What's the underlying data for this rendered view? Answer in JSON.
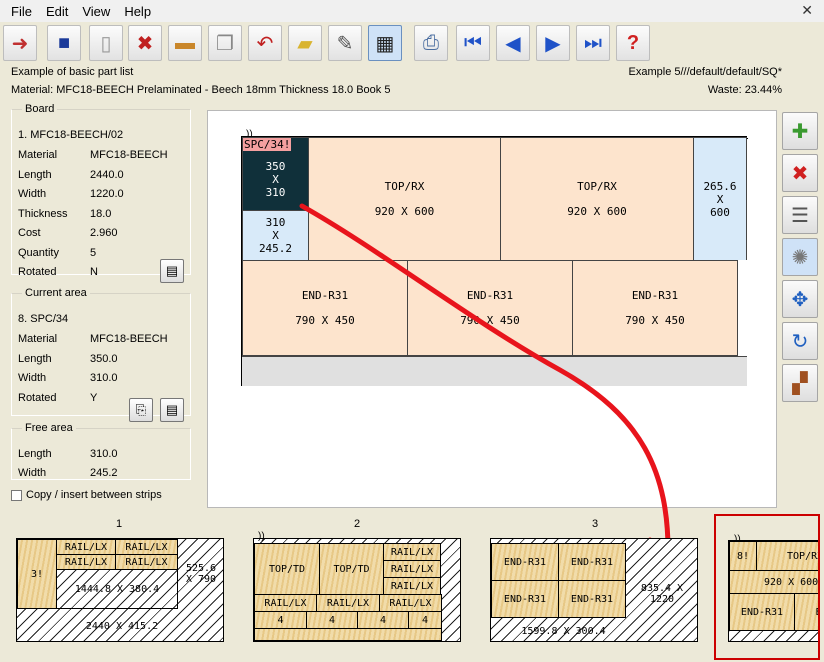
{
  "menu": [
    "File",
    "Edit",
    "View",
    "Help"
  ],
  "toolbar_icons": [
    "exit-icon",
    "save-icon",
    "new-icon",
    "delete-icon",
    "board-icon",
    "copy-icon",
    "undo-icon",
    "open-folder-icon",
    "edit-icon",
    "layout-icon",
    "print-icon",
    "first-icon",
    "previous-icon",
    "next-icon",
    "last-icon",
    "help-icon"
  ],
  "header": {
    "title": "Example of basic part list",
    "path": "Example 5///default/default/SQ*",
    "material": "Material: MFC18-BEECH Prelaminated - Beech 18mm Thickness  18.0 Book 5",
    "waste": "Waste: 23.44%"
  },
  "board": {
    "legend": "Board",
    "name": "1. MFC18-BEECH/02",
    "rows": [
      {
        "label": "Material",
        "value": "MFC18-BEECH"
      },
      {
        "label": "Length",
        "value": "2440.0"
      },
      {
        "label": "Width",
        "value": "1220.0"
      },
      {
        "label": "Thickness",
        "value": "18.0"
      },
      {
        "label": "Cost",
        "value": "2.960"
      },
      {
        "label": "Quantity",
        "value": "5"
      },
      {
        "label": "Rotated",
        "value": "N"
      }
    ]
  },
  "current": {
    "legend": "Current area",
    "name": "8. SPC/34",
    "rows": [
      {
        "label": "Material",
        "value": "MFC18-BEECH"
      },
      {
        "label": "Length",
        "value": "350.0"
      },
      {
        "label": "Width",
        "value": "310.0"
      },
      {
        "label": "Rotated",
        "value": "Y"
      }
    ]
  },
  "free": {
    "legend": "Free area",
    "rows": [
      {
        "label": "Length",
        "value": "310.0"
      },
      {
        "label": "Width",
        "value": "245.2"
      }
    ]
  },
  "copy_insert": "Copy / insert between strips",
  "layout": {
    "marker": "))",
    "sel_tag": "SPC/34!",
    "sel": [
      "350",
      "X",
      "310"
    ],
    "free": [
      "310",
      "X",
      "245.2"
    ],
    "top1": [
      "TOP/RX",
      "920 X 600"
    ],
    "top2": [
      "TOP/RX",
      "920 X 600"
    ],
    "side": [
      "265.6",
      "X",
      "600"
    ],
    "end1": [
      "END-R31",
      "790 X 450"
    ],
    "end2": [
      "END-R31",
      "790 X 450"
    ],
    "end3": [
      "END-R31",
      "790 X 450"
    ]
  },
  "strips": {
    "s1": {
      "num": "1",
      "a": "3!",
      "b": "RAIL/LX",
      "c": "RAIL/LX",
      "d": "RAIL/LX",
      "e": "RAIL/LX",
      "f": "1444.8 X 380.4",
      "g": "525.6 X 790",
      "h": "2440 X 415.2"
    },
    "s2": {
      "num": "2",
      "a": "TOP/TD",
      "b": "TOP/TD",
      "c": "RAIL/LX",
      "d": "RAIL/LX",
      "e": "RAIL/LX",
      "f": "RAIL/LX",
      "g": "RAIL/LX",
      "h": "RAIL/LX",
      "n1": "4",
      "n2": "4",
      "n3": "4",
      "n4": "4"
    },
    "s3": {
      "num": "3",
      "a": "END-R31",
      "b": "END-R31",
      "c": "END-R31",
      "d": "END-R31",
      "e": "835.4 X 1220",
      "f": "1599.8 X 300.4"
    },
    "s4": {
      "a": "8!",
      "b": "TOP/RX",
      "c": "920 X 600",
      "d": "END-R31",
      "e": "EN"
    }
  },
  "colors": {
    "piece": "#fde4cd",
    "free": "#d8eaf9",
    "selected": "#10303a",
    "arrow": "#e8141c"
  }
}
